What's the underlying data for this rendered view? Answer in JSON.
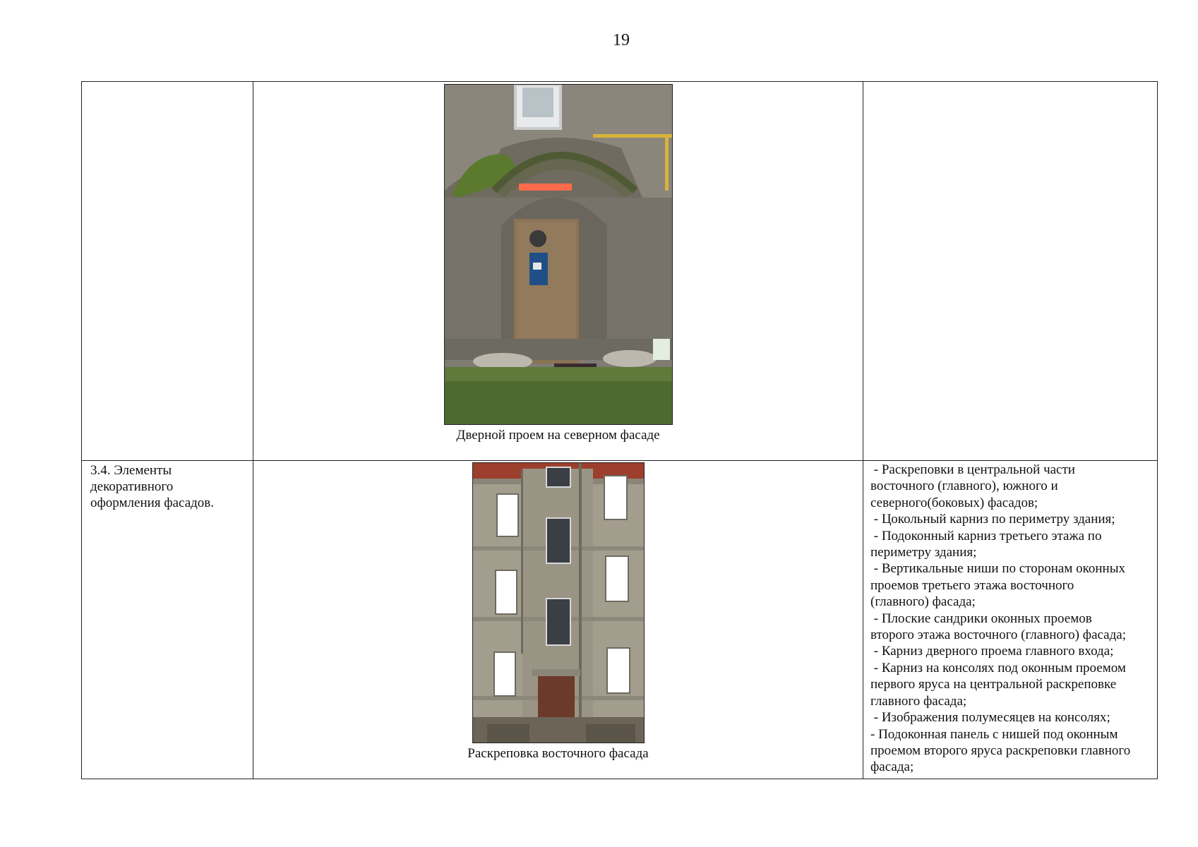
{
  "page": {
    "number": "19"
  },
  "table": {
    "row1": {
      "label": "",
      "photo": {
        "caption": "Дверной проем на северном фасаде",
        "subject": "arched-doorway-photo"
      },
      "notes": []
    },
    "row2": {
      "label": "3.4. Элементы\nдекоративного\nоформления фасадов.",
      "photo": {
        "caption": "Раскреповка восточного фасада",
        "subject": "east-facade-photo"
      },
      "notes": [
        " - Раскреповки в центральной части",
        "восточного (главного), южного и",
        "северного(боковых) фасадов;",
        " - Цокольный карниз по периметру здания;",
        " - Подоконный карниз третьего этажа по",
        "периметру здания;",
        " - Вертикальные ниши по сторонам оконных",
        "проемов третьего этажа восточного",
        "(главного) фасада;",
        " - Плоские сандрики оконных проемов",
        "второго этажа восточного (главного) фасада;",
        " - Карниз дверного проема главного входа;",
        " - Карниз на консолях под оконным проемом",
        "первого яруса на центральной раскреповке",
        "главного фасада;",
        " - Изображения полумесяцев на консолях;",
        "- Подоконная панель с нишей под оконным",
        "проемом второго яруса раскреповки главного",
        "фасада;"
      ]
    }
  }
}
